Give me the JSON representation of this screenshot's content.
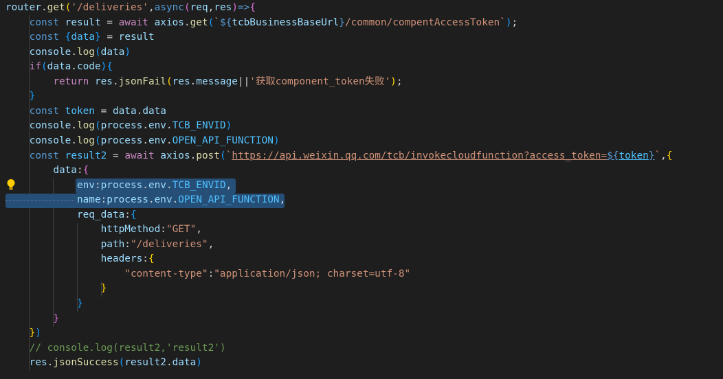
{
  "editor": {
    "lines": [
      [
        [
          "var",
          "router"
        ],
        [
          "p",
          "."
        ],
        [
          "fn",
          "get"
        ],
        [
          "b1",
          "("
        ],
        [
          "str",
          "'/deliveries'"
        ],
        [
          "p",
          ","
        ],
        [
          "kw",
          "async"
        ],
        [
          "b2",
          "("
        ],
        [
          "var",
          "req"
        ],
        [
          "p",
          ","
        ],
        [
          "var",
          "res"
        ],
        [
          "b2",
          ")"
        ],
        [
          "kw",
          "=>"
        ],
        [
          "b2",
          "{"
        ]
      ],
      [
        [
          "p",
          "    "
        ],
        [
          "kw",
          "const"
        ],
        [
          "p",
          " "
        ],
        [
          "var",
          "result"
        ],
        [
          "p",
          " = "
        ],
        [
          "ctl",
          "await"
        ],
        [
          "p",
          " "
        ],
        [
          "var",
          "axios"
        ],
        [
          "p",
          "."
        ],
        [
          "fn",
          "get"
        ],
        [
          "b3",
          "("
        ],
        [
          "str",
          "`"
        ],
        [
          "kw",
          "${"
        ],
        [
          "var",
          "tcbBusinessBaseUrl"
        ],
        [
          "kw",
          "}"
        ],
        [
          "str",
          "/common/compentAccessToken`"
        ],
        [
          "b3",
          ")"
        ],
        [
          "p",
          ";"
        ]
      ],
      [
        [
          "p",
          "    "
        ],
        [
          "kw",
          "const"
        ],
        [
          "p",
          " "
        ],
        [
          "b3",
          "{"
        ],
        [
          "cst",
          "data"
        ],
        [
          "b3",
          "}"
        ],
        [
          "p",
          " = "
        ],
        [
          "var",
          "result"
        ]
      ],
      [
        [
          "p",
          "    "
        ],
        [
          "var",
          "console"
        ],
        [
          "p",
          "."
        ],
        [
          "fn",
          "log"
        ],
        [
          "b3",
          "("
        ],
        [
          "var",
          "data"
        ],
        [
          "b3",
          ")"
        ]
      ],
      [
        [
          "p",
          "    "
        ],
        [
          "ctl",
          "if"
        ],
        [
          "b3",
          "("
        ],
        [
          "var",
          "data"
        ],
        [
          "p",
          "."
        ],
        [
          "var",
          "code"
        ],
        [
          "b3",
          ")"
        ],
        [
          "b3",
          "{"
        ]
      ],
      [
        [
          "p",
          "        "
        ],
        [
          "ctl",
          "return"
        ],
        [
          "p",
          " "
        ],
        [
          "var",
          "res"
        ],
        [
          "p",
          "."
        ],
        [
          "fn",
          "jsonFail"
        ],
        [
          "b1",
          "("
        ],
        [
          "var",
          "res"
        ],
        [
          "p",
          "."
        ],
        [
          "var",
          "message"
        ],
        [
          "p",
          "||"
        ],
        [
          "str",
          "'获取component_token失败'"
        ],
        [
          "b1",
          ")"
        ],
        [
          "p",
          ";"
        ]
      ],
      [
        [
          "p",
          "    "
        ],
        [
          "b3",
          "}"
        ]
      ],
      [
        [
          "p",
          "    "
        ],
        [
          "kw",
          "const"
        ],
        [
          "p",
          " "
        ],
        [
          "cst",
          "token"
        ],
        [
          "p",
          " = "
        ],
        [
          "var",
          "data"
        ],
        [
          "p",
          "."
        ],
        [
          "var",
          "data"
        ]
      ],
      [
        [
          "p",
          "    "
        ],
        [
          "var",
          "console"
        ],
        [
          "p",
          "."
        ],
        [
          "fn",
          "log"
        ],
        [
          "b3",
          "("
        ],
        [
          "var",
          "process"
        ],
        [
          "p",
          "."
        ],
        [
          "var",
          "env"
        ],
        [
          "p",
          "."
        ],
        [
          "cst",
          "TCB_ENVID"
        ],
        [
          "b3",
          ")"
        ]
      ],
      [
        [
          "p",
          "    "
        ],
        [
          "var",
          "console"
        ],
        [
          "p",
          "."
        ],
        [
          "fn",
          "log"
        ],
        [
          "b3",
          "("
        ],
        [
          "var",
          "process"
        ],
        [
          "p",
          "."
        ],
        [
          "var",
          "env"
        ],
        [
          "p",
          "."
        ],
        [
          "cst",
          "OPEN_API_FUNCTION"
        ],
        [
          "b3",
          ")"
        ]
      ],
      [
        [
          "p",
          "    "
        ],
        [
          "kw",
          "const"
        ],
        [
          "p",
          " "
        ],
        [
          "cst",
          "result2"
        ],
        [
          "p",
          " = "
        ],
        [
          "ctl",
          "await"
        ],
        [
          "p",
          " "
        ],
        [
          "var",
          "axios"
        ],
        [
          "p",
          "."
        ],
        [
          "fn",
          "post"
        ],
        [
          "b3",
          "("
        ],
        [
          "str",
          "`"
        ],
        [
          "str ul",
          "https://api.weixin.qq.com/tcb/invokecloudfunction?access_token="
        ],
        [
          "kw ul",
          "${"
        ],
        [
          "cst ul",
          "token"
        ],
        [
          "kw ul",
          "}"
        ],
        [
          "str",
          "`"
        ],
        [
          "p",
          ","
        ],
        [
          "b1",
          "{"
        ]
      ],
      [
        [
          "p",
          "        "
        ],
        [
          "var",
          "data"
        ],
        [
          "p",
          ":"
        ],
        [
          "b2",
          "{"
        ]
      ],
      [
        [
          "p",
          "            "
        ],
        [
          "var",
          "env"
        ],
        [
          "p",
          ":"
        ],
        [
          "var",
          "process"
        ],
        [
          "p",
          "."
        ],
        [
          "var",
          "env"
        ],
        [
          "p",
          "."
        ],
        [
          "cst",
          "TCB_ENVID"
        ],
        [
          "p",
          ","
        ]
      ],
      [
        [
          "p",
          "            "
        ],
        [
          "var",
          "name"
        ],
        [
          "p",
          ":"
        ],
        [
          "var",
          "process"
        ],
        [
          "p",
          "."
        ],
        [
          "var",
          "env"
        ],
        [
          "p",
          "."
        ],
        [
          "cst",
          "OPEN_API_FUNCTION"
        ],
        [
          "p",
          ","
        ]
      ],
      [
        [
          "p",
          "            "
        ],
        [
          "var",
          "req_data"
        ],
        [
          "p",
          ":"
        ],
        [
          "b3",
          "{"
        ]
      ],
      [
        [
          "p",
          "                "
        ],
        [
          "var",
          "httpMethod"
        ],
        [
          "p",
          ":"
        ],
        [
          "str",
          "\"GET\""
        ],
        [
          "p",
          ","
        ]
      ],
      [
        [
          "p",
          "                "
        ],
        [
          "var",
          "path"
        ],
        [
          "p",
          ":"
        ],
        [
          "str",
          "\"/deliveries\""
        ],
        [
          "p",
          ","
        ]
      ],
      [
        [
          "p",
          "                "
        ],
        [
          "var",
          "headers"
        ],
        [
          "p",
          ":"
        ],
        [
          "b1",
          "{"
        ]
      ],
      [
        [
          "p",
          "                    "
        ],
        [
          "str",
          "\"content-type\""
        ],
        [
          "p",
          ":"
        ],
        [
          "str",
          "\"application/json; charset=utf-8\""
        ]
      ],
      [
        [
          "p",
          "                "
        ],
        [
          "b1",
          "}"
        ]
      ],
      [
        [
          "p",
          "            "
        ],
        [
          "b3",
          "}"
        ]
      ],
      [
        [
          "p",
          "        "
        ],
        [
          "b2",
          "}"
        ]
      ],
      [
        [
          "p",
          "    "
        ],
        [
          "b1",
          "}"
        ],
        [
          "b3",
          ")"
        ]
      ],
      [
        [
          "p",
          "    "
        ],
        [
          "cmt",
          "// console.log(result2,'result2')"
        ]
      ],
      [
        [
          "p",
          "    "
        ],
        [
          "var",
          "res"
        ],
        [
          "p",
          "."
        ],
        [
          "fn",
          "jsonSuccess"
        ],
        [
          "b3",
          "("
        ],
        [
          "var",
          "result2"
        ],
        [
          "p",
          "."
        ],
        [
          "var",
          "data"
        ],
        [
          "b3",
          ")"
        ]
      ]
    ]
  }
}
